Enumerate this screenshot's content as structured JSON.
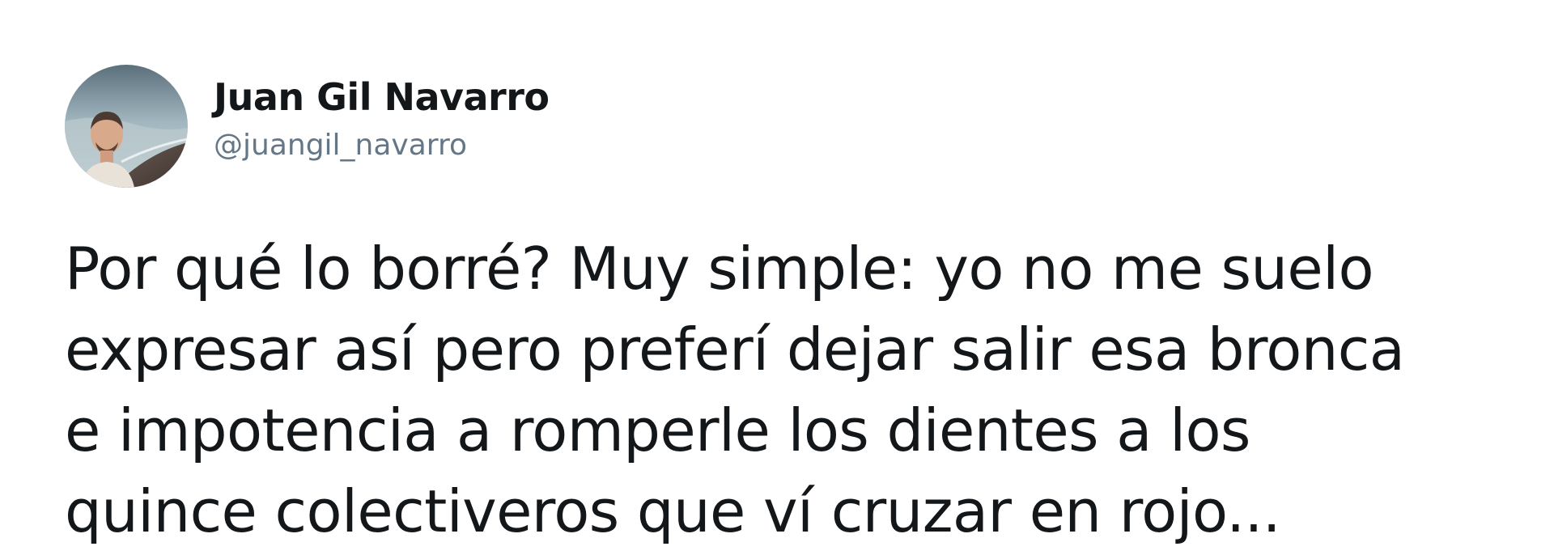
{
  "author": {
    "display_name": "Juan Gil Navarro",
    "handle": "@juangil_navarro",
    "avatar_icon": "profile-photo-avatar"
  },
  "tweet": {
    "lines": [
      "Por qué lo borré? Muy simple: yo no me suelo",
      "expresar así pero preferí dejar salir esa bronca",
      "e impotencia a romperle los dientes a los",
      "quince colectiveros que ví cruzar en rojo..."
    ]
  },
  "colors": {
    "text_primary": "#14171a",
    "text_secondary": "#657786",
    "background": "#ffffff"
  }
}
